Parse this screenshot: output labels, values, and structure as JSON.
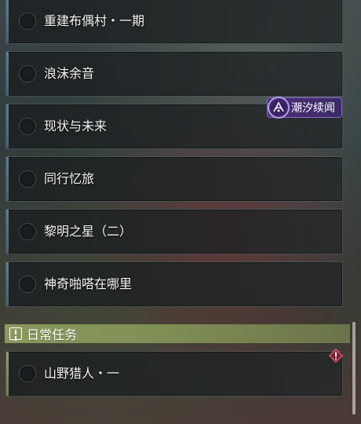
{
  "quests": [
    {
      "label": "重建布偶村・一期"
    },
    {
      "label": "浪沫余音"
    },
    {
      "label": "现状与未来"
    },
    {
      "label": "同行忆旅"
    },
    {
      "label": "黎明之星（二）"
    },
    {
      "label": "神奇啪嗒在哪里"
    }
  ],
  "tag": {
    "label": "潮汐续闻",
    "icon": "tidal-sequel-icon"
  },
  "daily_section": {
    "title": "日常任务",
    "icon": "info-icon"
  },
  "daily_quests": [
    {
      "label": "山野猎人・一",
      "badge_icon": "danger-diamond-icon"
    }
  ],
  "colors": {
    "card_bg": "#1e2224",
    "story_accent": "#5a7f9a",
    "daily_accent": "#8ea064",
    "section_header": "#8a9a5c",
    "tag_purple": "#4a2f78",
    "danger_red": "#d0455a"
  }
}
